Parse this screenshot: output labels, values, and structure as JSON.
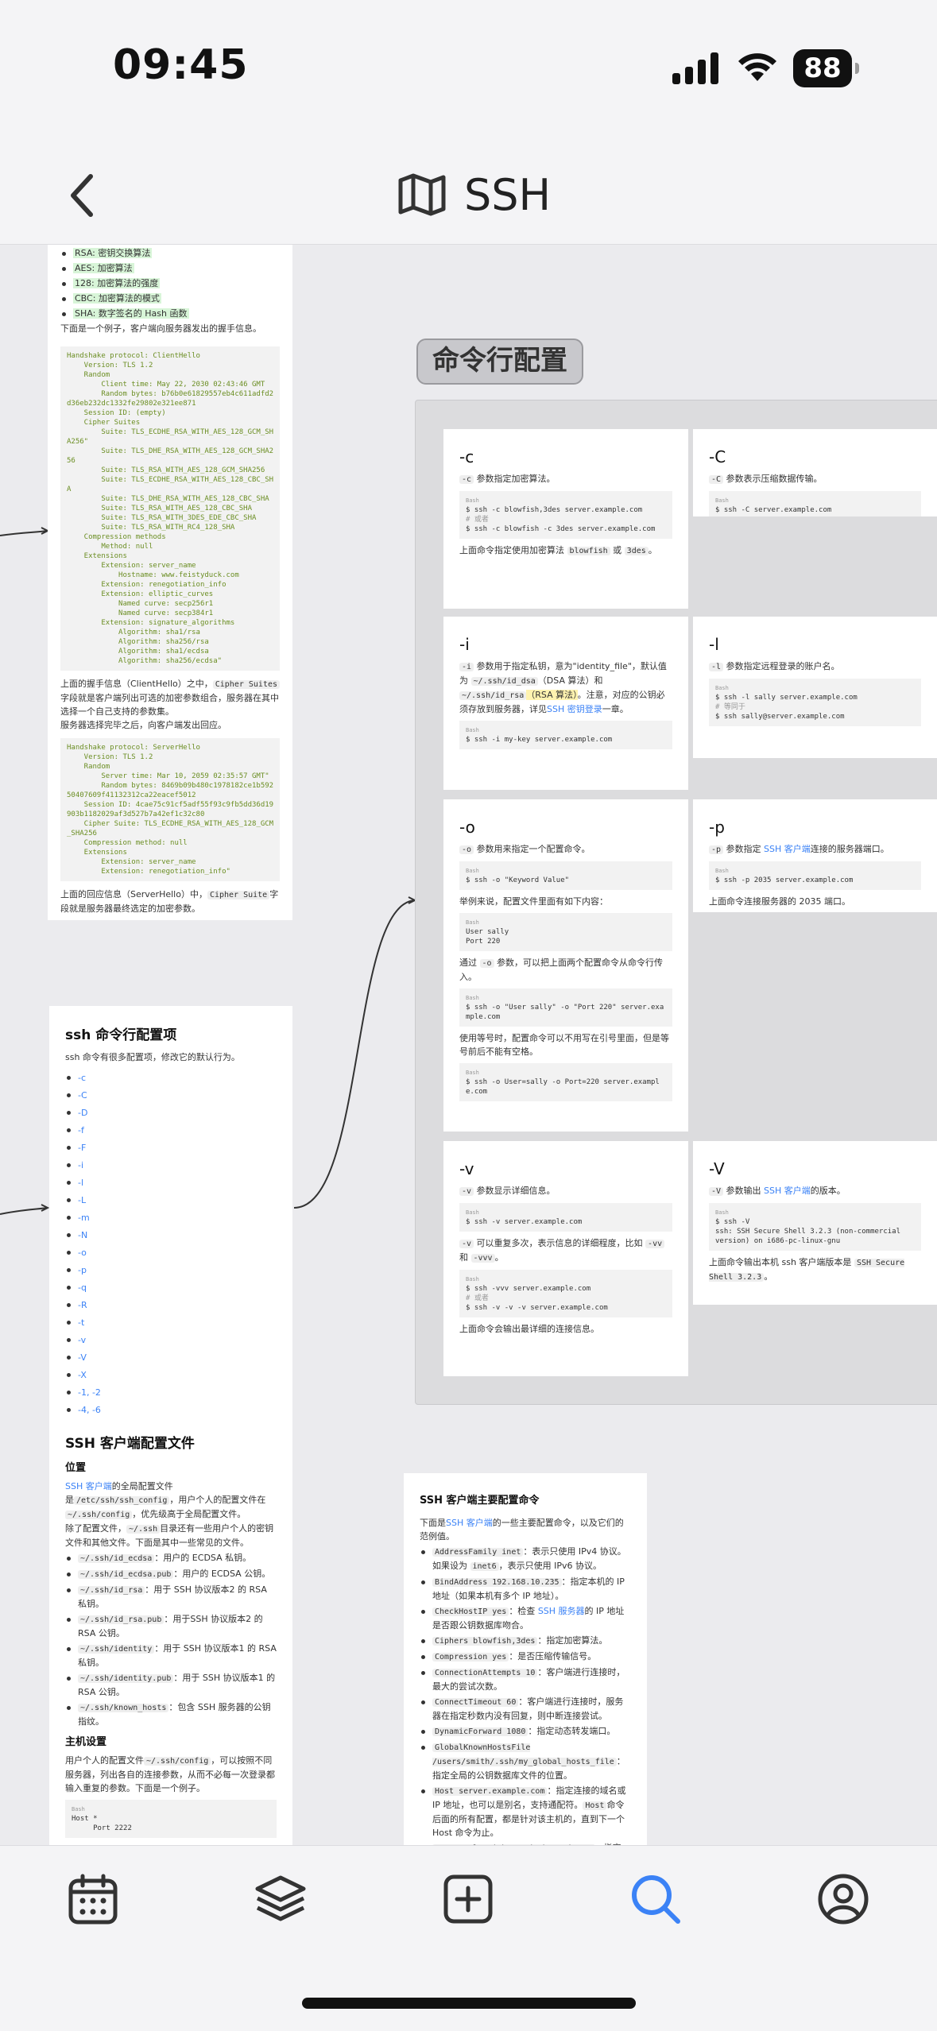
{
  "status": {
    "time": "09:45",
    "battery": "88"
  },
  "nav": {
    "title": "SSH",
    "back_icon": "chevron-left-icon",
    "title_icon": "map-icon"
  },
  "group": {
    "title": "命令行配置"
  },
  "handshake": {
    "bullets": [
      "RSA: 密钥交换算法",
      "AES: 加密算法",
      "128: 加密算法的强度",
      "CBC: 加密算法的模式",
      "SHA: 数字签名的 Hash 函数"
    ],
    "intro": "下面是一个例子，客户端向服务器发出的握手信息。",
    "code1": "Handshake protocol: ClientHello\n    Version: TLS 1.2\n    Random\n        Client time: May 22, 2030 02:43:46 GMT\n        Random bytes: b76b0e61829557eb4c611adfd2\nd36eb232dc1332fe29802e321ee871\n    Session ID: (empty)\n    Cipher Suites\n        Suite: TLS_ECDHE_RSA_WITH_AES_128_GCM_SH\nA256\"\n        Suite: TLS_DHE_RSA_WITH_AES_128_GCM_SHA2\n56\n        Suite: TLS_RSA_WITH_AES_128_GCM_SHA256\n        Suite: TLS_ECDHE_RSA_WITH_AES_128_CBC_SH\nA\n        Suite: TLS_DHE_RSA_WITH_AES_128_CBC_SHA\n        Suite: TLS_RSA_WITH_AES_128_CBC_SHA\n        Suite: TLS_RSA_WITH_3DES_EDE_CBC_SHA\n        Suite: TLS_RSA_WITH_RC4_128_SHA\n    Compression methods\n        Method: null\n    Extensions\n        Extension: server_name\n            Hostname: www.feistyduck.com\n        Extension: renegotiation_info\n        Extension: elliptic_curves\n            Named curve: secp256r1\n            Named curve: secp384r1\n        Extension: signature_algorithms\n            Algorithm: sha1/rsa\n            Algorithm: sha256/rsa\n            Algorithm: sha1/ecdsa\n            Algorithm: sha256/ecdsa\"",
    "mid1": "上面的握手信息（ClientHello）之中，",
    "mid_code": "Cipher Suites",
    "mid2": "字段就是客户端列出可选的加密参数组合，服务器在其中选择一个自己支持的参数集。",
    "mid3": "服务器选择完毕之后，向客户端发出回应。",
    "code2": "Handshake protocol: ServerHello\n    Version: TLS 1.2\n    Random\n        Server time: Mar 10, 2059 02:35:57 GMT\"\n        Random bytes: 8469b09b480c1978182ce1b592\n50407609f41132312ca22eacef5012\n    Session ID: 4cae75c91cf5adf55f93c9fb5dd36d19\n903b1182029af3d527b7a42ef1c32c80\n    Cipher Suite: TLS_ECDHE_RSA_WITH_AES_128_GCM\n_SHA256\n    Compression method: null\n    Extensions\n        Extension: server_name\n        Extension: renegotiation_info\"",
    "end1": "上面的回应信息（ServerHello）中，",
    "end_code": "Cipher Suite",
    "end2": "字段就是服务器最终选定的加密参数。"
  },
  "options": {
    "title": "ssh 命令行配置项",
    "desc": "ssh 命令有很多配置项，修改它的默认行为。",
    "items": [
      "-c",
      "-C",
      "-D",
      "-f",
      "-F",
      "-i",
      "-l",
      "-L",
      "-m",
      "-N",
      "-o",
      "-p",
      "-q",
      "-R",
      "-t",
      "-v",
      "-V",
      "-X",
      "-1, -2",
      "-4, -6"
    ]
  },
  "client_config": {
    "title": "SSH 客户端配置文件",
    "h_location": "位置",
    "p1_link": "SSH 客户端",
    "p1a": "的全局配置文件是",
    "p1_code": "/etc/ssh/ssh_config",
    "p1b": "，用户个人的配置文件在",
    "p1_code2": "~/.ssh/config",
    "p1c": "，优先级高于全局配置文件。",
    "p2a": "除了配置文件，",
    "p2_code": "~/.ssh",
    "p2b": "目录还有一些用户个人的密钥文件和其他文件。下面是其中一些常见的文件。",
    "files": [
      {
        "code": "~/.ssh/id_ecdsa",
        "text": "：用户的 ECDSA 私钥。"
      },
      {
        "code": "~/.ssh/id_ecdsa.pub",
        "text": "：用户的 ECDSA 公钥。"
      },
      {
        "code": "~/.ssh/id_rsa",
        "text": "：用于 SSH 协议版本2 的 RSA 私钥。"
      },
      {
        "code": "~/.ssh/id_rsa.pub",
        "text": "：用于SSH 协议版本2 的 RSA 公钥。"
      },
      {
        "code": "~/.ssh/identity",
        "text": "：用于 SSH 协议版本1 的 RSA 私钥。"
      },
      {
        "code": "~/.ssh/identity.pub",
        "text": "：用于 SSH 协议版本1 的 RSA 公钥。"
      },
      {
        "code": "~/.ssh/known_hosts",
        "text": "：包含 SSH 服务器的公钥指纹。"
      }
    ],
    "h_host": "主机设置",
    "p3a": "用户个人的配置文件",
    "p3_code": "~/.ssh/config",
    "p3b": "，可以按照不同服务器，列出各自的连接参数，从而不必每一次登录都输入重复的参数。下面是一个例子。",
    "code": "Host *\n     Port 2222"
  },
  "main_cmds": {
    "title": "SSH 客户端主要配置命令",
    "intro_a": "下面是",
    "intro_link": "SSH 客户端",
    "intro_b": "的一些主要配置命令，以及它们的范例值。",
    "items": [
      {
        "code": "AddressFamily inet",
        "text": "：表示只使用 IPv4 协议。如果设为 ",
        "code2": "inet6",
        "text2": "，表示只使用 IPv6 协议。"
      },
      {
        "code": "BindAddress 192.168.10.235",
        "text": "：指定本机的 IP 地址（如果本机有多个 IP 地址）。",
        "code2": "",
        "text2": ""
      },
      {
        "code": "CheckHostIP yes",
        "text": "：检查 ",
        "link": "SSH 服务器",
        "text2": "的 IP 地址是否跟公钥数据库吻合。"
      },
      {
        "code": "Ciphers blowfish,3des",
        "text": "：指定加密算法。",
        "code2": "",
        "text2": ""
      },
      {
        "code": "Compression yes",
        "text": "：是否压缩传输信号。",
        "code2": "",
        "text2": ""
      },
      {
        "code": "ConnectionAttempts 10",
        "text": "：客户端进行连接时，最大的尝试次数。",
        "code2": "",
        "text2": ""
      },
      {
        "code": "ConnectTimeout 60",
        "text": "：客户端进行连接时，服务器在指定秒数内没有回复，则中断连接尝试。",
        "code2": "",
        "text2": ""
      },
      {
        "code": "DynamicForward 1080",
        "text": "：指定动态转发端口。",
        "code2": "",
        "text2": ""
      },
      {
        "code": "GlobalKnownHostsFile /users/smith/.ssh/my_global_hosts_file",
        "text": "：指定全局的公钥数据库文件的位置。",
        "code2": "",
        "text2": ""
      },
      {
        "code": "Host server.example.com",
        "text": "：指定连接的域名或 IP 地址，也可以是别名，支持通配符。",
        "code2": "Host",
        "text2": "命令后面的所有配置，都是针对该主机的，直到下一个 Host 命令为止。"
      },
      {
        "code": "HostKeyAlgorithms ssh-dss,ssh-rsa",
        "text": "：指定",
        "code2": "",
        "text2": ""
      }
    ]
  },
  "cmd_c": {
    "title": "-c",
    "desc_code": "-c",
    "desc": " 参数指定加密算法。",
    "lbl": "Bash",
    "l1": "$ ssh -c blowfish,3des server.example.com",
    "l2": "# 或者",
    "l3": "$ ssh -c blowfish -c 3des server.example.com",
    "foot_a": "上面命令指定使用加密算法 ",
    "foot_c1": "blowfish",
    "foot_b": " 或 ",
    "foot_c2": "3des",
    "foot_c": "。"
  },
  "cmd_C": {
    "title": "-C",
    "desc_code": "-C",
    "desc": " 参数表示压缩数据传输。",
    "lbl": "Bash",
    "l1": "$ ssh -C server.example.com"
  },
  "cmd_i": {
    "title": "-i",
    "desc_code": "-i",
    "desc_a": " 参数用于指定私钥，意为\"identity_file\"，默认值为 ",
    "desc_c1": "~/.ssh/id_dsa",
    "desc_b": "（DSA 算法）和 ",
    "desc_c2": "~/.ssh/id_rsa",
    "desc_hl": "（RSA 算法）",
    "desc_c": "。注意，对应的公钥必须存放到服务器，详见",
    "desc_link": "SSH 密钥登录",
    "desc_d": "一章。",
    "lbl": "Bash",
    "l1": "$ ssh -i my-key server.example.com"
  },
  "cmd_l": {
    "title": "-l",
    "desc_code": "-l",
    "desc": " 参数指定远程登录的账户名。",
    "lbl": "Bash",
    "l1": "$ ssh -l sally server.example.com",
    "l2": "# 等同于",
    "l3": "$ ssh sally@server.example.com"
  },
  "cmd_o": {
    "title": "-o",
    "desc_code": "-o",
    "desc": " 参数用来指定一个配置命令。",
    "lbl": "Bash",
    "l1": "$ ssh -o \"Keyword Value\"",
    "p1": "举例来说，配置文件里面有如下内容：",
    "cfg1": "User sally",
    "cfg2": "Port 220",
    "p2a": "通过 ",
    "p2_code": "-o",
    "p2b": " 参数，可以把上面两个配置命令从命令行传入。",
    "l2": "$ ssh -o \"User sally\" -o \"Port 220\" server.example.com",
    "p3": "使用等号时，配置命令可以不用写在引号里面，但是等号前后不能有空格。",
    "l3": "$ ssh -o User=sally -o Port=220 server.example.com"
  },
  "cmd_p": {
    "title": "-p",
    "desc_code": "-p",
    "desc_a": " 参数指定 ",
    "desc_link": "SSH 客户端",
    "desc_b": "连接的服务器端口。",
    "lbl": "Bash",
    "l1": "$ ssh -p 2035 server.example.com",
    "foot": "上面命令连接服务器的 2035 端口。"
  },
  "cmd_v": {
    "title": "-v",
    "desc_code": "-v",
    "desc": " 参数显示详细信息。",
    "lbl": "Bash",
    "l1": "$ ssh -v server.example.com",
    "p1a": "",
    "p1_code": "-v",
    "p1b": " 可以重复多次，表示信息的详细程度，比如 ",
    "p1_code2": "-vv",
    "p1c": " 和 ",
    "p1_code3": "-vvv",
    "p1d": "。",
    "l2": "$ ssh -vvv server.example.com",
    "l3": "# 或者",
    "l4": "$ ssh -v -v -v server.example.com",
    "foot": "上面命令会输出最详细的连接信息。"
  },
  "cmd_V": {
    "title": "-V",
    "desc_code": "-V",
    "desc_a": " 参数输出 ",
    "desc_link": "SSH 客户端",
    "desc_b": "的版本。",
    "lbl": "Bash",
    "l1": "$ ssh -V",
    "l2": "ssh: SSH Secure Shell 3.2.3 (non-commercial version) on i686-pc-linux-gnu",
    "foot_a": "上面命令输出本机 ssh 客户端版本是 ",
    "foot_code": "SSH Secure Shell 3.2.3",
    "foot_b": "。"
  },
  "tabs": [
    "calendar-icon",
    "layers-icon",
    "add-square-icon",
    "search-icon",
    "profile-icon"
  ],
  "colors": {
    "accent": "#3b82f6",
    "code_green": "#6b8e23",
    "flag_red": "#d23b3b"
  }
}
